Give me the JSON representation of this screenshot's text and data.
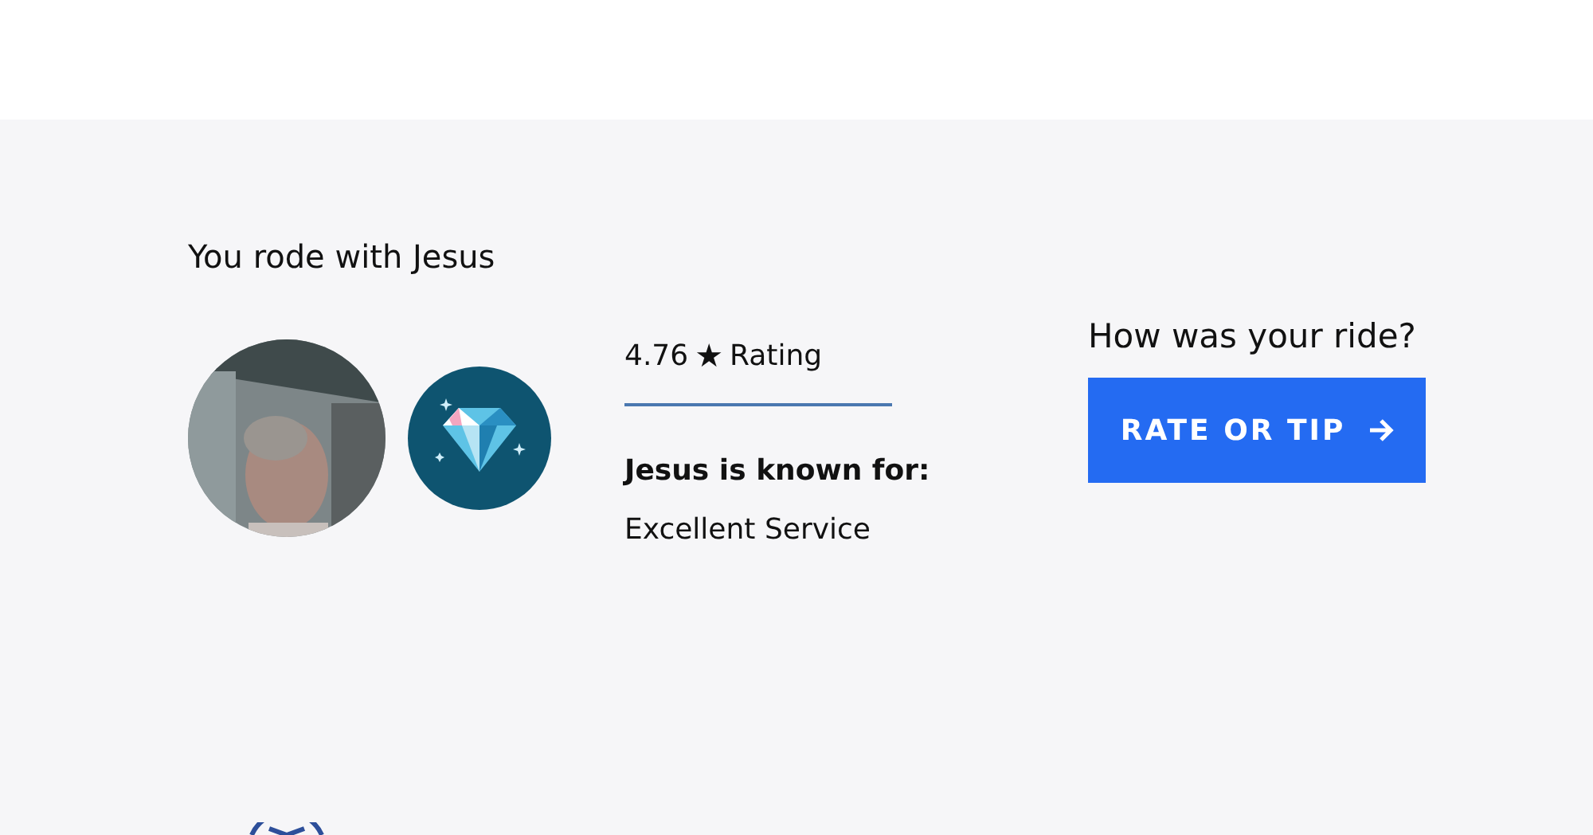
{
  "heading": "You rode with Jesus",
  "driver": {
    "rating": "4.76",
    "rating_star": "★",
    "rating_label": "Rating",
    "known_for_title": "Jesus is known for:",
    "compliments": [
      "Excellent Service"
    ]
  },
  "feedback": {
    "question": "How was your ride?",
    "button": "RATE OR TIP"
  }
}
